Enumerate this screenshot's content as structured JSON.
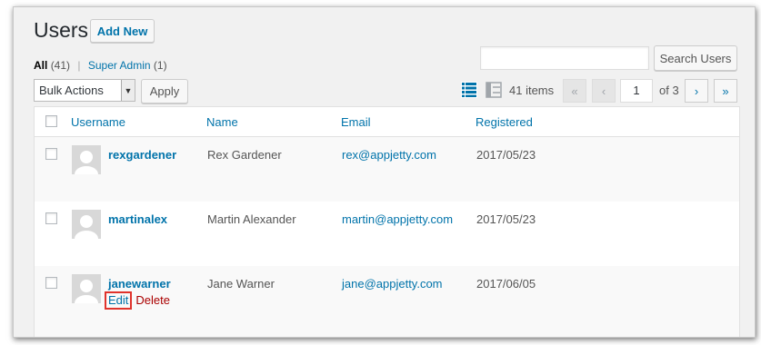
{
  "header": {
    "title": "Users",
    "add_new_label": "Add New"
  },
  "views": [
    {
      "label": "All",
      "count": "(41)",
      "current": true
    },
    {
      "label": "Super Admin",
      "count": "(1)",
      "current": false
    }
  ],
  "search": {
    "value": "",
    "button_label": "Search Users"
  },
  "bulk_actions": {
    "selected": "Bulk Actions",
    "apply_label": "Apply"
  },
  "pagination": {
    "item_count": "41 items",
    "first": "«",
    "prev": "‹",
    "current_page": "1",
    "total": "of 3",
    "next": "›",
    "last": "»"
  },
  "table": {
    "columns": [
      "Username",
      "Name",
      "Email",
      "Registered"
    ],
    "rows": [
      {
        "username": "rexgardener",
        "name": "Rex Gardener",
        "email": "rex@appjetty.com",
        "registered": "2017/05/23"
      },
      {
        "username": "martinalex",
        "name": "Martin Alexander",
        "email": "martin@appjetty.com",
        "registered": "2017/05/23"
      },
      {
        "username": "janewarner",
        "name": "Jane Warner",
        "email": "jane@appjetty.com",
        "registered": "2017/06/05",
        "row_actions": {
          "edit": "Edit",
          "delete": "Delete"
        }
      }
    ]
  },
  "colors": {
    "link": "#0073aa",
    "highlight": "#e0332c",
    "delete": "#aa0000"
  },
  "icons": [
    "list-view-icon",
    "excerpt-view-icon",
    "checkbox-icon",
    "avatar-placeholder-icon",
    "dropdown-arrow-icon"
  ]
}
